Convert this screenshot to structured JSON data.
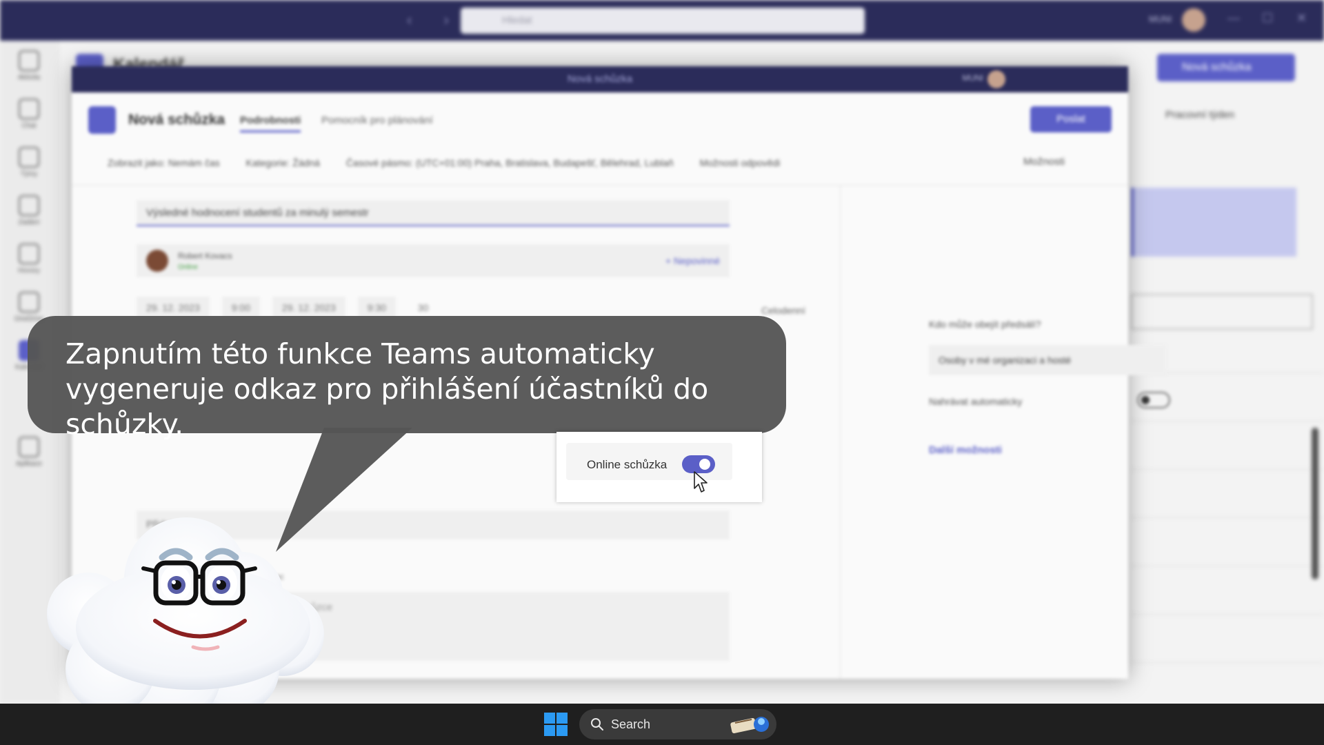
{
  "teams": {
    "search_placeholder": "Hledat",
    "user_initials": "MUNI",
    "calendar_title": "Kalendář",
    "new_meeting_button": "Nová schůzka",
    "week_view": "Pracovní týden",
    "rail": [
      "Aktivita",
      "Chat",
      "Týmy",
      "Zadání",
      "Hovory",
      "OneDrive",
      "Kalendář",
      "Aplikace"
    ]
  },
  "dialog": {
    "window_title": "Nová schůzka",
    "user_initials": "MUNI",
    "header_title": "Nová schůzka",
    "tabs": [
      "Podrobnosti",
      "Pomocník pro plánování"
    ],
    "send_button": "Poslat",
    "options_bar": [
      "Zobrazit jako: Nemám čas",
      "Kategorie: Žádná",
      "Časové pásmo: (UTC+01:00) Praha, Bratislava, Budapešť, Bělehrad, Lublaň",
      "Možnosti odpovědi"
    ],
    "more": "Možnosti",
    "title_value": "Výsledné hodnocení studentů za minulý semestr",
    "attendee_name": "Robert Kovacs",
    "attendee_status": "Online",
    "optional_link": "+ Nepovinné",
    "start_date": "29. 12. 2023",
    "start_time": "9:00",
    "end_date": "29. 12. 2023",
    "end_time": "9:30",
    "duration": "30",
    "all_day": "Celodenní",
    "location_placeholder": "Přidat místo",
    "font_size": "Odstavec",
    "body_placeholder": "Zadejte podrobnosti o této nové schůzce",
    "present_label": "Kdo může obejít předsálí?",
    "present_value": "Osoby v mé organizaci a hosté",
    "record_label": "Nahrávat automaticky",
    "more_options": "Další možnosti"
  },
  "highlight": {
    "label": "Online schůzka",
    "toggle_on": true
  },
  "bubble": {
    "text": "Zapnutím této funkce Teams automaticky vygeneruje odkaz pro přihlášení účastníků do schůzky."
  },
  "taskbar": {
    "search_label": "Search"
  },
  "colors": {
    "teams_accent": "#5b5fc7",
    "titlebar": "#2b2c5a",
    "bubble": "#555555",
    "taskbar": "#1f1f1f"
  }
}
